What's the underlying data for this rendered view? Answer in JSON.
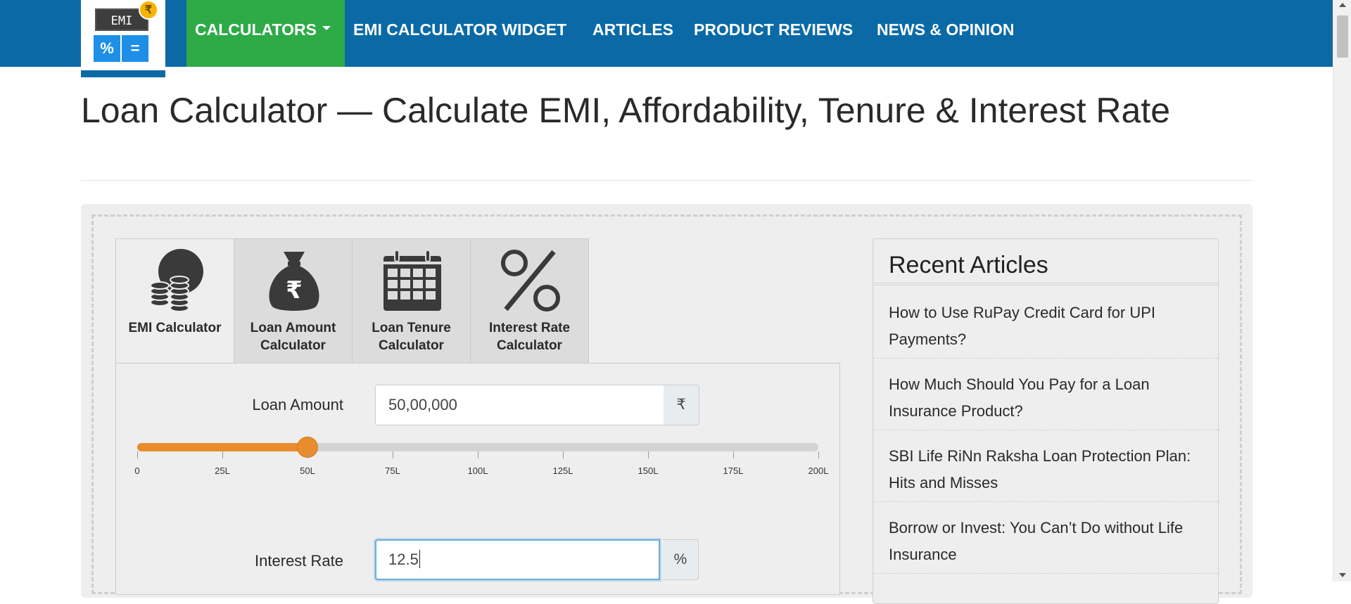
{
  "nav": {
    "logo": {
      "screen_text": "EMI",
      "coin_symbol": "₹",
      "key1": "%",
      "key2": "="
    },
    "items": [
      {
        "label": "CALCULATORS",
        "active": true,
        "dropdown": true
      },
      {
        "label": "EMI CALCULATOR WIDGET"
      },
      {
        "label": "ARTICLES"
      },
      {
        "label": "PRODUCT REVIEWS"
      },
      {
        "label": "NEWS & OPINION"
      }
    ]
  },
  "page": {
    "title": "Loan Calculator — Calculate EMI, Affordability, Tenure & Interest Rate"
  },
  "tabs": [
    {
      "label": "EMI Calculator",
      "icon": "coins-icon",
      "active": true
    },
    {
      "label": "Loan Amount Calculator",
      "icon": "money-bag-icon"
    },
    {
      "label": "Loan Tenure Calculator",
      "icon": "calendar-icon"
    },
    {
      "label": "Interest Rate Calculator",
      "icon": "percent-icon"
    }
  ],
  "form": {
    "loan_amount": {
      "label": "Loan Amount",
      "value": "50,00,000",
      "unit": "₹"
    },
    "slider": {
      "min": 0,
      "max": 200,
      "value": 50,
      "ticks": [
        "0",
        "25L",
        "50L",
        "75L",
        "100L",
        "125L",
        "150L",
        "175L",
        "200L"
      ],
      "fill_color": "#e98c2e"
    },
    "interest_rate": {
      "label": "Interest Rate",
      "value": "12.5",
      "unit": "%"
    }
  },
  "sidebar": {
    "title": "Recent Articles",
    "articles": [
      "How to Use RuPay Credit Card for UPI Payments?",
      "How Much Should You Pay for a Loan Insurance Product?",
      "SBI Life RiNn Raksha Loan Protection Plan: Hits and Misses",
      "Borrow or Invest: You Can’t Do without Life Insurance"
    ]
  },
  "colors": {
    "nav_bg": "#0b6aa6",
    "nav_active": "#2eaa47",
    "accent": "#e98c2e"
  }
}
